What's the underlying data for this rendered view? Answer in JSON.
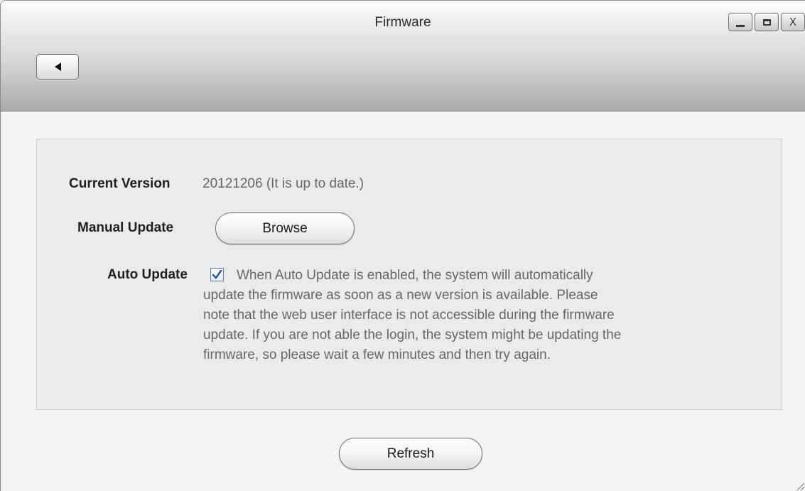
{
  "window": {
    "title": "Firmware",
    "controls": {
      "minimize_icon": "minimize-icon",
      "maximize_icon": "maximize-icon",
      "close_label": "X"
    }
  },
  "toolbar": {
    "back_icon": "back-arrow-icon"
  },
  "firmware": {
    "current_version_label": "Current Version",
    "current_version_value": "20121206 (It is up to date.)",
    "manual_update_label": "Manual Update",
    "browse_button_label": "Browse",
    "auto_update_label": "Auto Update",
    "auto_update_checked": true,
    "auto_update_description_lines": [
      "When Auto Update is enabled, the system will automatically",
      "update the firmware as soon as a new version is available. Please",
      "note that the web user interface is not accessible during the firmware",
      "update. If you are not able the login, the system might be updating the",
      "firmware, so please wait a few minutes and then try again."
    ]
  },
  "footer": {
    "refresh_button_label": "Refresh"
  },
  "colors": {
    "label_text": "#1f1f1f",
    "value_text": "#666666",
    "panel_background": "#ebebeb",
    "checkbox_check": "#2a4f9a"
  }
}
